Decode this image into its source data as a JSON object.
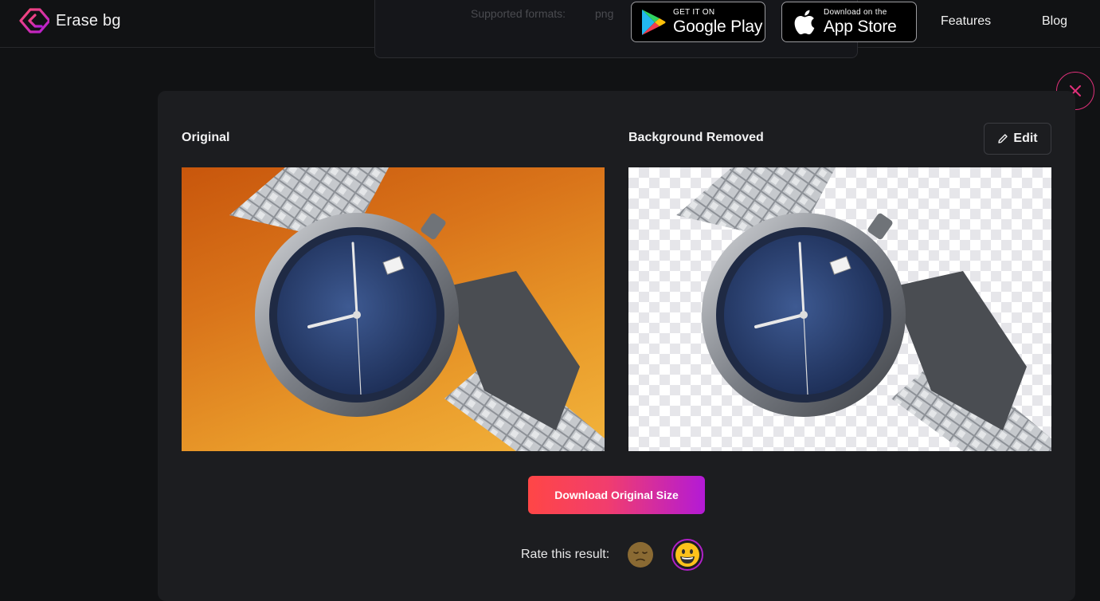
{
  "app": {
    "name": "Erase bg"
  },
  "header": {
    "formats_label": "Supported formats:",
    "formats_value": "png",
    "google_play": {
      "small": "GET IT ON",
      "big": "Google Play"
    },
    "app_store": {
      "small": "Download on the",
      "big": "App Store"
    },
    "nav": {
      "features": "Features",
      "blog": "Blog"
    }
  },
  "result": {
    "original_title": "Original",
    "removed_title": "Background Removed",
    "edit_label": "Edit",
    "download_label": "Download Original Size",
    "rate_label": "Rate this result:"
  },
  "icons": {
    "logo": "erase-bg-logo-icon",
    "close": "close-icon",
    "edit": "pencil-icon",
    "rate_bad": "pensive-face-icon",
    "rate_good": "grinning-face-icon"
  },
  "colors": {
    "accent_pink": "#e0307a",
    "download_gradient_start": "#ff4646",
    "download_gradient_end": "#b31ad6",
    "panel_bg": "#1c1d20",
    "page_bg": "#111214"
  }
}
